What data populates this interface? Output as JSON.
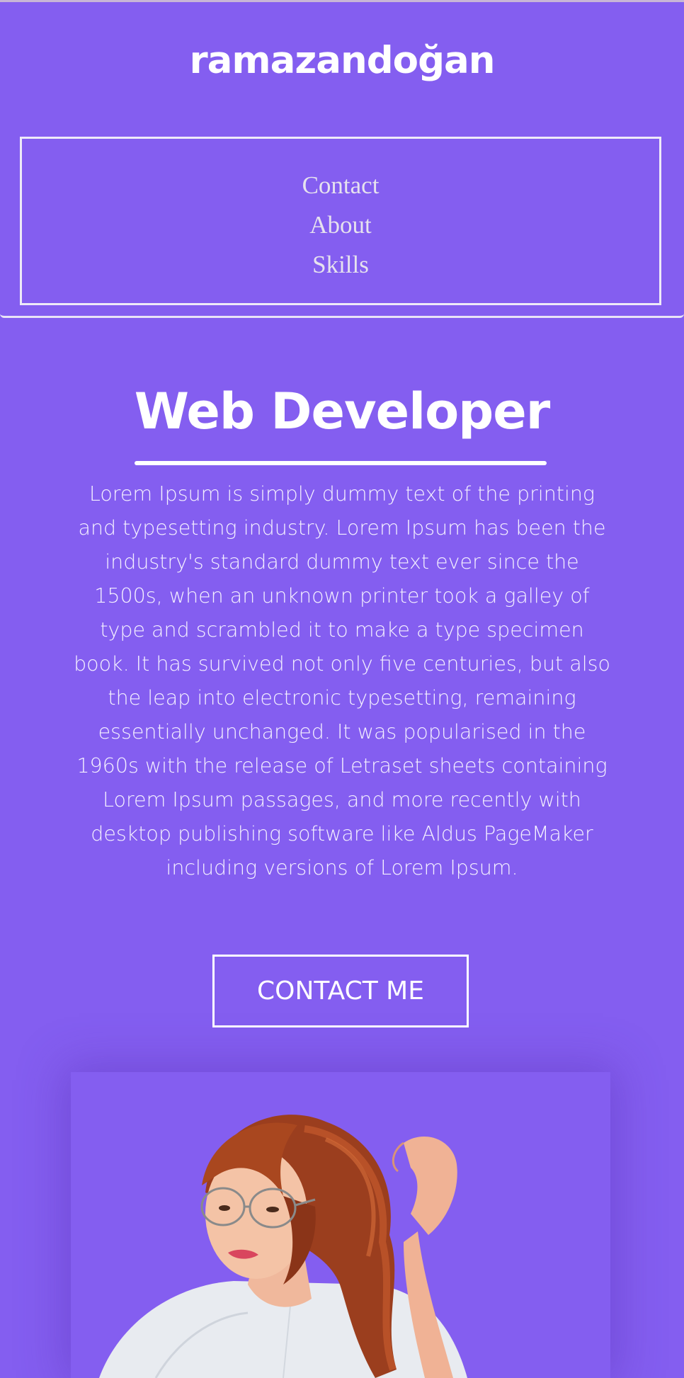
{
  "header": {
    "brand": "ramazandoğan",
    "nav": [
      {
        "label": "Contact"
      },
      {
        "label": "About"
      },
      {
        "label": "Skills"
      }
    ]
  },
  "hero": {
    "title": "Web Developer",
    "description": "Lorem Ipsum is simply dummy text of the printing and typesetting industry. Lorem Ipsum has been the industry's standard dummy text ever since the 1500s, when an unknown printer took a galley of type and scrambled it to make a type specimen book. It has survived not only five centuries, but also the leap into electronic typesetting, remaining essentially unchanged. It was popularised in the 1960s with the release of Letraset sheets containing Lorem Ipsum passages, and more recently with desktop publishing software like Aldus PageMaker including versions of Lorem Ipsum.",
    "cta_label": "CONTACT ME"
  },
  "photo": {
    "subject": "portrait-photo"
  },
  "colors": {
    "background": "#845ef0",
    "text": "#ffffff",
    "nav_text": "#e6e2ee"
  }
}
